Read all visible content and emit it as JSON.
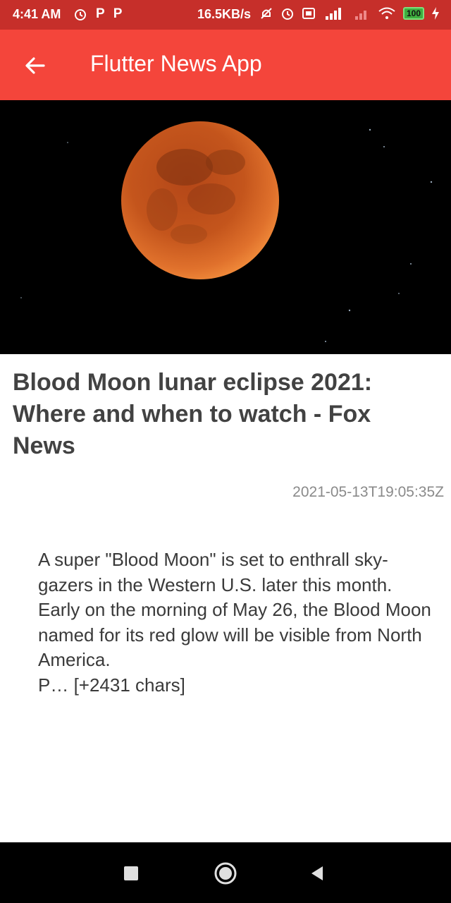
{
  "status_bar": {
    "time": "4:41 AM",
    "left_icons": [
      "alarm-icon",
      "p-notification-icon",
      "p-notification-icon"
    ],
    "p_letter": "P",
    "speed": "16.5KB/s",
    "battery": "100",
    "right_icons": [
      "mute-alarm-icon",
      "alarm-icon",
      "volte-icon",
      "signal-4g-icon",
      "signal-icon",
      "wifi-icon",
      "battery-icon",
      "charging-icon"
    ]
  },
  "app_bar": {
    "title": "Flutter News App",
    "back_icon": "back-arrow-icon"
  },
  "colors": {
    "status_bar": "#c62f2a",
    "app_bar": "#f4453b",
    "headline": "#424242",
    "date": "#8a8a8a",
    "body": "#3a3a3a"
  },
  "article": {
    "image": "blood-moon-image",
    "title": "Blood Moon lunar eclipse 2021: Where and when to watch - Fox News",
    "published_at": "2021-05-13T19:05:35Z",
    "content": "A super \"Blood Moon\" is set to enthrall sky-gazers in the Western U.S. later this month.\nEarly on the morning of May 26, the Blood Moon named for its red glow will be visible from North America.\nP… [+2431 chars]"
  },
  "nav_bar": {
    "items": [
      "recents-square-icon",
      "home-circle-icon",
      "back-triangle-icon"
    ]
  }
}
